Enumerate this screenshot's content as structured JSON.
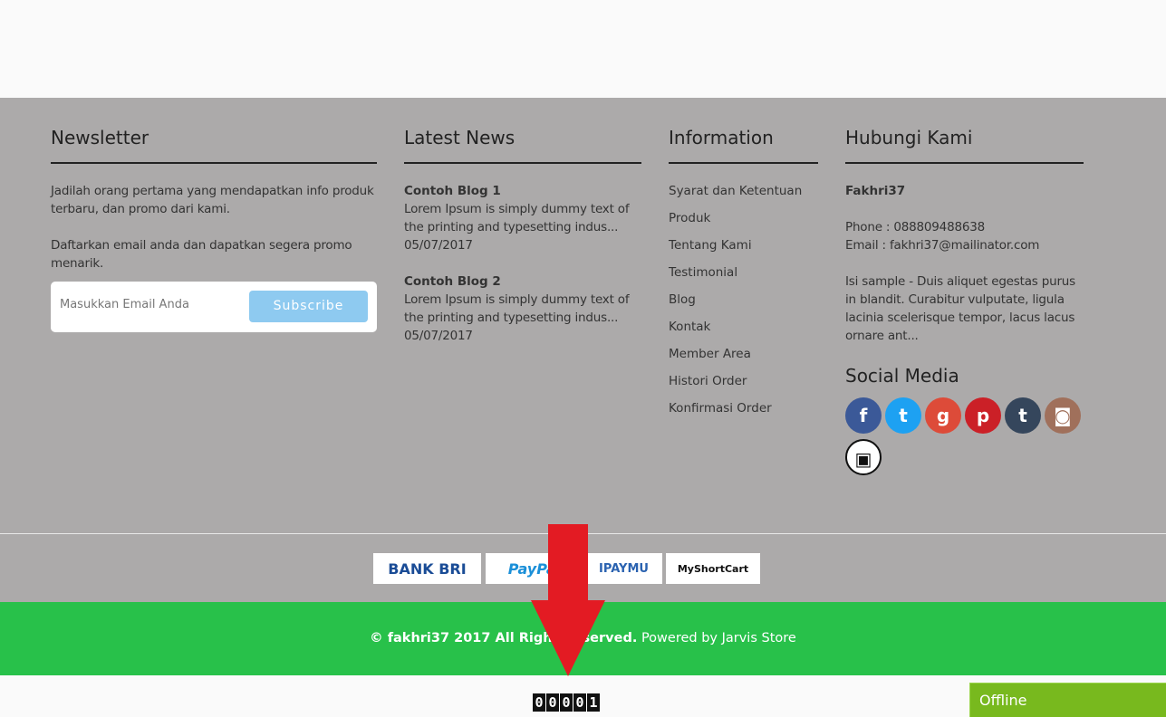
{
  "newsletter": {
    "title": "Newsletter",
    "text1": "Jadilah orang pertama yang mendapatkan info produk terbaru, dan promo dari kami.",
    "text2": "Daftarkan email anda dan dapatkan segera promo menarik.",
    "email_placeholder": "Masukkan Email Anda",
    "subscribe_label": "Subscribe"
  },
  "latest_news": {
    "title": "Latest News",
    "items": [
      {
        "title": "Contoh Blog 1",
        "excerpt": "Lorem Ipsum is simply dummy text of the printing and typesetting indus...",
        "date": "05/07/2017"
      },
      {
        "title": "Contoh Blog 2",
        "excerpt": "Lorem Ipsum is simply dummy text of the printing and typesetting indus...",
        "date": "05/07/2017"
      }
    ]
  },
  "information": {
    "title": "Information",
    "links": [
      "Syarat dan Ketentuan",
      "Produk",
      "Tentang Kami",
      "Testimonial",
      "Blog",
      "Kontak",
      "Member Area",
      "Histori Order",
      "Konfirmasi Order"
    ]
  },
  "contact": {
    "title": "Hubungi Kami",
    "name": "Fakhri37",
    "phone": "Phone : 088809488638",
    "email": "Email : fakhri37@mailinator.com",
    "desc": "Isi sample - Duis aliquet egestas purus in blandit. Curabitur vulputate, ligula lacinia scelerisque tempor, lacus lacus ornare ant...",
    "social_title": "Social Media",
    "social": [
      {
        "name": "facebook-icon",
        "glyph": "f",
        "color": "#3b5998"
      },
      {
        "name": "twitter-icon",
        "glyph": "t",
        "color": "#1da1f2"
      },
      {
        "name": "google-plus-icon",
        "glyph": "g",
        "color": "#dd4b39"
      },
      {
        "name": "pinterest-icon",
        "glyph": "p",
        "color": "#cb2027"
      },
      {
        "name": "tumblr-icon",
        "glyph": "t",
        "color": "#35465c"
      },
      {
        "name": "instagram-icon",
        "glyph": "◙",
        "color": "#a0705b"
      },
      {
        "name": "chat-icon",
        "glyph": "▣",
        "color": "#ffffff"
      }
    ]
  },
  "payments": [
    "BANK BRI",
    "PayPal",
    "IPAYMU",
    "MyShortCart"
  ],
  "footer": {
    "copyright": "© fakhri37 2017 All Right Reserved.",
    "powered": "Powered by Jarvis Store"
  },
  "counter": [
    "0",
    "0",
    "0",
    "0",
    "1"
  ],
  "chat_status": "Offline"
}
